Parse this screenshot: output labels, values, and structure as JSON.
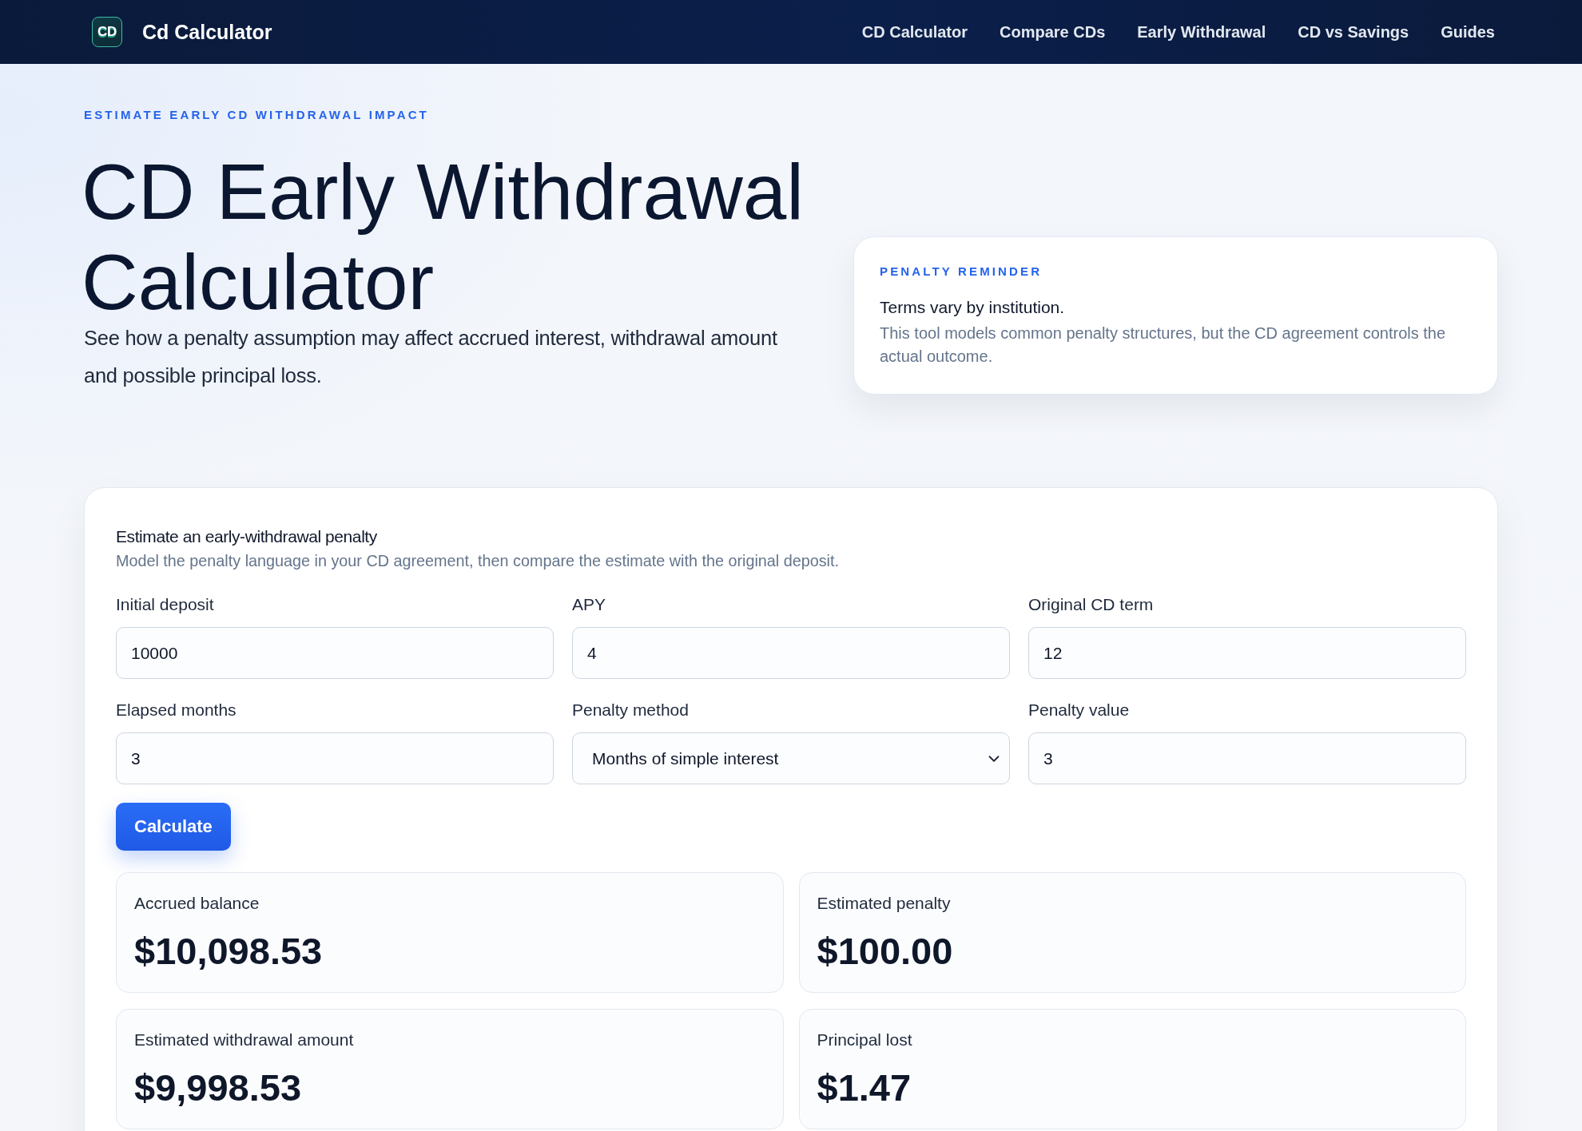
{
  "header": {
    "logo": "CD",
    "brand": "Cd Calculator",
    "nav": [
      {
        "label": "CD Calculator"
      },
      {
        "label": "Compare CDs"
      },
      {
        "label": "Early Withdrawal"
      },
      {
        "label": "CD vs Savings"
      },
      {
        "label": "Guides"
      }
    ]
  },
  "hero": {
    "eyebrow": "ESTIMATE EARLY CD WITHDRAWAL IMPACT",
    "title": "CD Early Withdrawal Calculator",
    "subtitle": "See how a penalty assumption may affect accrued interest, withdrawal amount and possible principal loss.",
    "reminder": {
      "label": "PENALTY REMINDER",
      "heading": "Terms vary by institution.",
      "text": "This tool models common penalty structures, but the CD agreement controls the actual outcome."
    }
  },
  "calculator": {
    "title": "Estimate an early-withdrawal penalty",
    "description": "Model the penalty language in your CD agreement, then compare the estimate with the original deposit.",
    "fields": [
      {
        "label": "Initial deposit",
        "kind": "input",
        "value": "10000"
      },
      {
        "label": "APY",
        "kind": "input",
        "value": "4"
      },
      {
        "label": "Original CD term",
        "kind": "input",
        "value": "12"
      },
      {
        "label": "Elapsed months",
        "kind": "input",
        "value": "3"
      },
      {
        "label": "Penalty method",
        "kind": "select",
        "value": "Months of simple interest"
      },
      {
        "label": "Penalty value",
        "kind": "input",
        "value": "3"
      }
    ],
    "button": "Calculate",
    "results": [
      {
        "label": "Accrued balance",
        "value": "$10,098.53"
      },
      {
        "label": "Estimated penalty",
        "value": "$100.00"
      },
      {
        "label": "Estimated withdrawal amount",
        "value": "$9,998.53"
      },
      {
        "label": "Principal lost",
        "value": "$1.47"
      }
    ]
  }
}
